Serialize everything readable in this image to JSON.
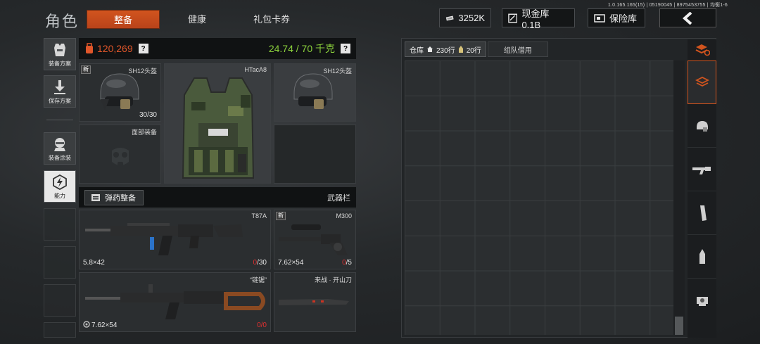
{
  "version": "1.0.165.165(15) | 05190045 | 8975453755 | 均衡1-6",
  "page_title": "角色",
  "tabs": [
    {
      "label": "整备",
      "active": true
    },
    {
      "label": "健康",
      "active": false
    },
    {
      "label": "礼包卡券",
      "active": false
    }
  ],
  "top_bar": {
    "money": "3252K",
    "cash_vault": "现金库 0.1B",
    "safe_box": "保险库"
  },
  "left_menu": {
    "loadout_plan": "装备方案",
    "save_plan": "保存方案",
    "equip_paint": "装备涂装",
    "ability": "能力"
  },
  "stats": {
    "value": "120,269",
    "help": "?",
    "weight": "24.74 / 70 千克"
  },
  "gear": {
    "helmet": {
      "name": "SH12头盔",
      "badge": "新",
      "durability": "30/30"
    },
    "armor": {
      "name": "HTacA8"
    },
    "helmet_skin": {
      "name": "SH12头盔"
    },
    "face": {
      "name": "面部装备"
    }
  },
  "ammo_button": "弹药整备",
  "weapon_bar_label": "武器栏",
  "weapons": {
    "primary": {
      "name": "T87A",
      "caliber": "5.8×42",
      "ammo_current": "0",
      "ammo_max": "/30"
    },
    "sniper": {
      "name": "M300",
      "badge": "新",
      "caliber": "7.62×54",
      "ammo_current": "0",
      "ammo_max": "/5"
    },
    "secondary": {
      "name": "“链锯”",
      "caliber": "7.62×54",
      "ammo_current": "0",
      "ammo_max": "/0"
    },
    "melee": {
      "name": "来战 · 开山刀"
    }
  },
  "warehouse": {
    "tab_label": "仓库",
    "rows_home": "230行",
    "rows_extra": "20行",
    "team_tab": "组队借用"
  },
  "colors": {
    "accent": "#d2541e",
    "weight_green": "#8bd13c",
    "money_orange": "#e0562a",
    "ammo_red": "#e03030"
  }
}
